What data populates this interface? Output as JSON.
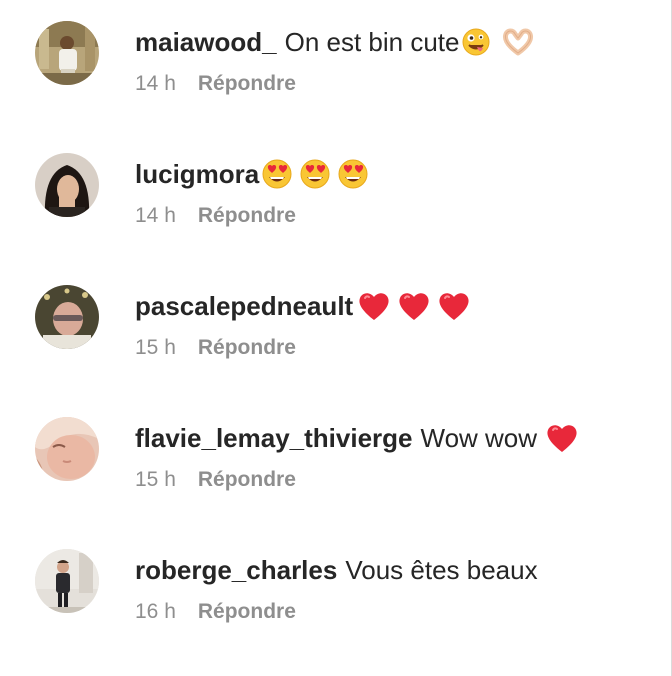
{
  "comments": [
    {
      "username": "maiawood_",
      "text": "On est bin cute",
      "emojis": [
        "zany-face",
        "heart-hands"
      ],
      "time": "14 h",
      "reply": "Répondre"
    },
    {
      "username": "lucigmora",
      "text": "",
      "emojis": [
        "heart-eyes",
        "heart-eyes",
        "heart-eyes"
      ],
      "time": "14 h",
      "reply": "Répondre"
    },
    {
      "username": "pascalepedneault",
      "text": "",
      "emojis": [
        "red-heart",
        "red-heart",
        "red-heart"
      ],
      "time": "15 h",
      "reply": "Répondre"
    },
    {
      "username": "flavie_lemay_thivierge",
      "text": "Wow wow",
      "emojis": [
        "red-heart"
      ],
      "time": "15 h",
      "reply": "Répondre"
    },
    {
      "username": "roberge_charles",
      "text": "Vous êtes beaux",
      "emojis": [],
      "time": "16 h",
      "reply": "Répondre"
    }
  ]
}
